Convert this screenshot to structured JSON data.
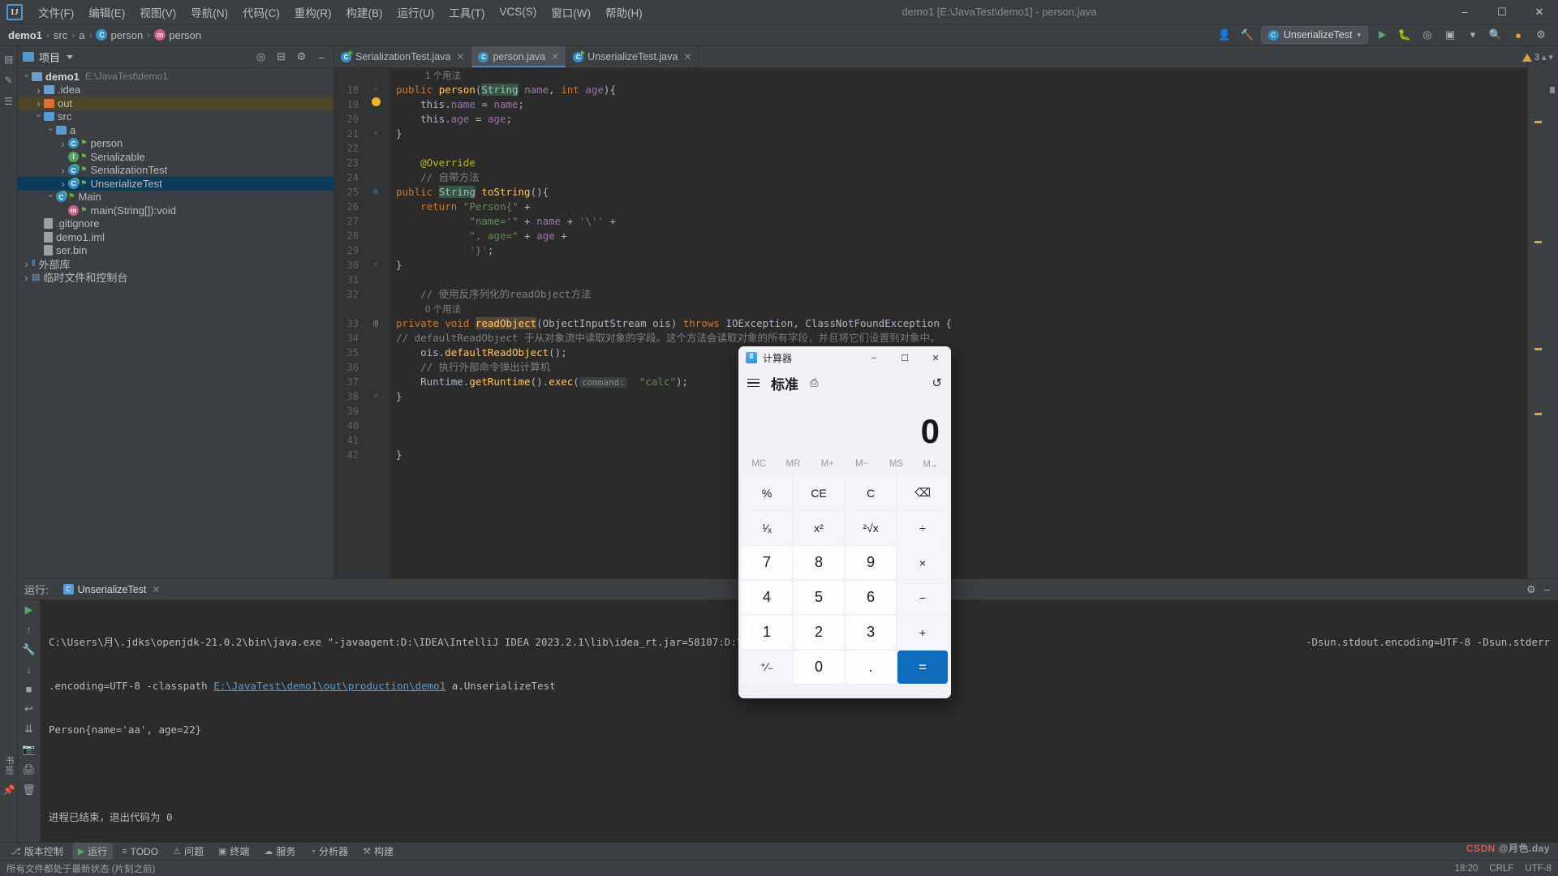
{
  "window": {
    "title": "demo1 [E:\\JavaTest\\demo1] - person.java",
    "logo": "IJ",
    "minimize": "–",
    "maximize": "☐",
    "close": "✕"
  },
  "menubar": [
    {
      "label": "文件(F)",
      "name": "menu-file"
    },
    {
      "label": "编辑(E)",
      "name": "menu-edit"
    },
    {
      "label": "视图(V)",
      "name": "menu-view"
    },
    {
      "label": "导航(N)",
      "name": "menu-navigate"
    },
    {
      "label": "代码(C)",
      "name": "menu-code"
    },
    {
      "label": "重构(R)",
      "name": "menu-refactor"
    },
    {
      "label": "构建(B)",
      "name": "menu-build"
    },
    {
      "label": "运行(U)",
      "name": "menu-run"
    },
    {
      "label": "工具(T)",
      "name": "menu-tools"
    },
    {
      "label": "VCS(S)",
      "name": "menu-vcs"
    },
    {
      "label": "窗口(W)",
      "name": "menu-window"
    },
    {
      "label": "帮助(H)",
      "name": "menu-help"
    }
  ],
  "breadcrumb": [
    {
      "label": "demo1",
      "icon": "",
      "bold": true
    },
    {
      "label": "src",
      "icon": "",
      "bold": false
    },
    {
      "label": "a",
      "icon": "",
      "bold": false
    },
    {
      "label": "person",
      "icon": "C",
      "bold": false
    },
    {
      "label": "person",
      "icon": "m",
      "bold": false
    }
  ],
  "navbar_right": {
    "run_config": "UnserializeTest",
    "run_config_icon": "C",
    "search_icon": "search-icon",
    "settings_icon": "gear-icon",
    "account_icon": "account-icon",
    "updates_icon": "updates-icon"
  },
  "project_panel": {
    "title": "项目",
    "tree": [
      {
        "depth": 0,
        "arrow": "down",
        "icon": "folder-module",
        "label": "demo1",
        "path": "E:\\JavaTest\\demo1",
        "bold": true,
        "state": "none"
      },
      {
        "depth": 1,
        "arrow": "right",
        "icon": "folder-blue",
        "label": ".idea",
        "path": "",
        "bold": false,
        "state": "none"
      },
      {
        "depth": 1,
        "arrow": "right",
        "icon": "folder-orange",
        "label": "out",
        "path": "",
        "bold": false,
        "state": "highlight"
      },
      {
        "depth": 1,
        "arrow": "down",
        "icon": "folder-src",
        "label": "src",
        "path": "",
        "bold": false,
        "state": "none"
      },
      {
        "depth": 2,
        "arrow": "down",
        "icon": "folder-pkg",
        "label": "a",
        "path": "",
        "bold": false,
        "state": "none"
      },
      {
        "depth": 3,
        "arrow": "right",
        "icon": "class",
        "label": "person",
        "path": "",
        "bold": false,
        "state": "none"
      },
      {
        "depth": 3,
        "arrow": "none",
        "icon": "interface",
        "label": "Serializable",
        "path": "",
        "bold": false,
        "state": "none"
      },
      {
        "depth": 3,
        "arrow": "right",
        "icon": "class-run",
        "label": "SerializationTest",
        "path": "",
        "bold": false,
        "state": "none"
      },
      {
        "depth": 3,
        "arrow": "right",
        "icon": "class-run",
        "label": "UnserializeTest",
        "path": "",
        "bold": false,
        "state": "selected"
      },
      {
        "depth": 2,
        "arrow": "down",
        "icon": "class-run",
        "label": "Main",
        "path": "",
        "bold": false,
        "state": "none"
      },
      {
        "depth": 3,
        "arrow": "none",
        "icon": "method",
        "label": "main(String[]):void",
        "path": "",
        "bold": false,
        "state": "none"
      },
      {
        "depth": 1,
        "arrow": "none",
        "icon": "file",
        "label": ".gitignore",
        "path": "",
        "bold": false,
        "state": "none"
      },
      {
        "depth": 1,
        "arrow": "none",
        "icon": "file",
        "label": "demo1.iml",
        "path": "",
        "bold": false,
        "state": "none"
      },
      {
        "depth": 1,
        "arrow": "none",
        "icon": "file",
        "label": "ser.bin",
        "path": "",
        "bold": false,
        "state": "none"
      },
      {
        "depth": 0,
        "arrow": "right",
        "icon": "library",
        "label": "外部库",
        "path": "",
        "bold": false,
        "state": "none"
      },
      {
        "depth": 0,
        "arrow": "right",
        "icon": "scratch",
        "label": "临时文件和控制台",
        "path": "",
        "bold": false,
        "state": "none"
      }
    ]
  },
  "editor": {
    "tabs": [
      {
        "label": "SerializationTest.java",
        "active": false,
        "runnable": true
      },
      {
        "label": "person.java",
        "active": true,
        "runnable": false
      },
      {
        "label": "UnserializeTest.java",
        "active": false,
        "runnable": true
      }
    ],
    "warning_count": "3",
    "lines": [
      {
        "num": "",
        "hint": "1 个用法",
        "indent": 1
      },
      {
        "num": "18",
        "code": "public person(String name, int age){"
      },
      {
        "num": "19",
        "code": "    this.name = name;"
      },
      {
        "num": "20",
        "code": "    this.age = age;"
      },
      {
        "num": "21",
        "code": "}"
      },
      {
        "num": "22",
        "code": ""
      },
      {
        "num": "23",
        "code": "    @Override"
      },
      {
        "num": "24",
        "code": "    // 自带方法"
      },
      {
        "num": "25",
        "code": "public String toString(){"
      },
      {
        "num": "26",
        "code": "    return \"Person{\" +"
      },
      {
        "num": "27",
        "code": "            \"name='\" + name + '\\'' +"
      },
      {
        "num": "28",
        "code": "            \", age=\" + age +"
      },
      {
        "num": "29",
        "code": "            '}';"
      },
      {
        "num": "30",
        "code": "}"
      },
      {
        "num": "31",
        "code": ""
      },
      {
        "num": "32",
        "code": "    // 使用反序列化的readObject方法"
      },
      {
        "num": "",
        "hint": "0 个用法"
      },
      {
        "num": "33",
        "code": "private void readObject(ObjectInputStream ois) throws IOException, ClassNotFoundException {"
      },
      {
        "num": "34",
        "code": "// defaultReadObject 于从对象流中读取对象的字段。这个方法会读取对象的所有字段，并且将它们设置到对象中。"
      },
      {
        "num": "35",
        "code": "    ois.defaultReadObject();"
      },
      {
        "num": "36",
        "code": "    // 执行外部命令弹出计算机"
      },
      {
        "num": "37",
        "code": "    Runtime.getRuntime().exec( command: \"calc\");"
      },
      {
        "num": "38",
        "code": "}"
      },
      {
        "num": "39",
        "code": ""
      },
      {
        "num": "40",
        "code": ""
      },
      {
        "num": "41",
        "code": ""
      },
      {
        "num": "42",
        "code": "}"
      }
    ]
  },
  "run_panel": {
    "label": "运行:",
    "tab": "UnserializeTest",
    "console_line1": "C:\\Users\\月\\.jdks\\openjdk-21.0.2\\bin\\java.exe \"-javaagent:D:\\IDEA\\IntelliJ IDEA 2023.2.1\\lib\\idea_rt.jar=58107:D:\\IntelliJ",
    "console_line1_tail": "-Dsun.stdout.encoding=UTF-8 -Dsun.stderr",
    "console_line2_pre": ".encoding=UTF-8 -classpath ",
    "console_line2_link": "E:\\JavaTest\\demo1\\out\\production\\demo1",
    "console_line2_post": " a.UnserializeTest",
    "console_line3": "Person{name='aa', age=22}",
    "console_line4": "进程已结束，退出代码为 0"
  },
  "bottom_bar": [
    {
      "label": "版本控制",
      "icon": "branch-icon",
      "active": false
    },
    {
      "label": "运行",
      "icon": "play-icon",
      "active": true
    },
    {
      "label": "TODO",
      "icon": "list-icon",
      "active": false
    },
    {
      "label": "问题",
      "icon": "warning-icon",
      "active": false
    },
    {
      "label": "终端",
      "icon": "terminal-icon",
      "active": false
    },
    {
      "label": "服务",
      "icon": "services-icon",
      "active": false
    },
    {
      "label": "分析器",
      "icon": "profiler-icon",
      "active": false
    },
    {
      "label": "构建",
      "icon": "hammer-icon",
      "active": false
    }
  ],
  "status_bar": {
    "message": "所有文件都处于最新状态 (片刻之前)",
    "time": "18:20",
    "line_sep": "CRLF",
    "extra": "UTF-8"
  },
  "calculator": {
    "app_name": "计算器",
    "minimize": "–",
    "maximize": "☐",
    "close": "✕",
    "mode": "标准",
    "pin_icon": "pin-icon",
    "history_icon": "history-icon",
    "display_value": "0",
    "memory": [
      "MC",
      "MR",
      "M+",
      "M−",
      "MS",
      "M⌄"
    ],
    "buttons": [
      {
        "label": "%",
        "type": "func",
        "name": "percent-button"
      },
      {
        "label": "CE",
        "type": "func",
        "name": "clear-entry-button"
      },
      {
        "label": "C",
        "type": "func",
        "name": "clear-button"
      },
      {
        "label": "⌫",
        "type": "func",
        "name": "backspace-button"
      },
      {
        "label": "¹⁄ₓ",
        "type": "func",
        "name": "reciprocal-button"
      },
      {
        "label": "x²",
        "type": "func",
        "name": "square-button"
      },
      {
        "label": "²√x",
        "type": "func",
        "name": "sqrt-button"
      },
      {
        "label": "÷",
        "type": "func",
        "name": "divide-button"
      },
      {
        "label": "7",
        "type": "digit",
        "name": "digit-7-button"
      },
      {
        "label": "8",
        "type": "digit",
        "name": "digit-8-button"
      },
      {
        "label": "9",
        "type": "digit",
        "name": "digit-9-button"
      },
      {
        "label": "×",
        "type": "func",
        "name": "multiply-button"
      },
      {
        "label": "4",
        "type": "digit",
        "name": "digit-4-button"
      },
      {
        "label": "5",
        "type": "digit",
        "name": "digit-5-button"
      },
      {
        "label": "6",
        "type": "digit",
        "name": "digit-6-button"
      },
      {
        "label": "−",
        "type": "func",
        "name": "subtract-button"
      },
      {
        "label": "1",
        "type": "digit",
        "name": "digit-1-button"
      },
      {
        "label": "2",
        "type": "digit",
        "name": "digit-2-button"
      },
      {
        "label": "3",
        "type": "digit",
        "name": "digit-3-button"
      },
      {
        "label": "+",
        "type": "func",
        "name": "add-button"
      },
      {
        "label": "⁺⁄₋",
        "type": "func",
        "name": "negate-button"
      },
      {
        "label": "0",
        "type": "digit",
        "name": "digit-0-button"
      },
      {
        "label": ".",
        "type": "digit",
        "name": "decimal-button"
      },
      {
        "label": "=",
        "type": "equals",
        "name": "equals-button"
      }
    ]
  },
  "watermark": {
    "main": "CSDN",
    "sub": "@月色.day"
  },
  "colors": {
    "accent": "#4a88c7",
    "selection": "#0d3a58",
    "keyword": "#cc7832",
    "string": "#6a8759",
    "calc_accent": "#0f6cbd"
  }
}
